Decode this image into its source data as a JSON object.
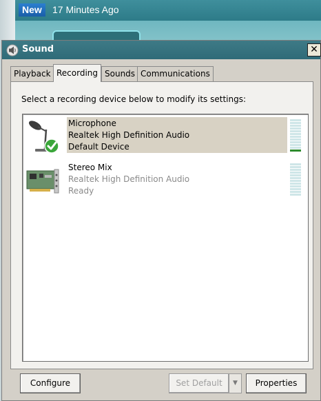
{
  "background": {
    "badge": "New",
    "time_ago": "17 Minutes Ago"
  },
  "window": {
    "title": "Sound",
    "close_glyph": "✕"
  },
  "tabs": [
    {
      "label": "Playback"
    },
    {
      "label": "Recording",
      "active": true
    },
    {
      "label": "Sounds"
    },
    {
      "label": "Communications"
    }
  ],
  "panel": {
    "instruction": "Select a recording device below to modify its settings:"
  },
  "devices": [
    {
      "name": "Microphone",
      "driver": "Realtek High Definition Audio",
      "status": "Default Device",
      "icon": "microphone-icon",
      "selected": true,
      "level": 0.08
    },
    {
      "name": "Stereo Mix",
      "driver": "Realtek High Definition Audio",
      "status": "Ready",
      "icon": "sound-card-icon",
      "selected": false,
      "level": 0
    }
  ],
  "buttons": {
    "configure": "Configure",
    "set_default": "Set Default",
    "split_arrow": "▼",
    "properties": "Properties"
  },
  "colors": {
    "titlebar": "#2f6b78",
    "selection": "#d8d2c4",
    "meter_on": "#2e8b2e",
    "meter_off": "#cfe6e8",
    "default_check": "#3aa63a"
  }
}
